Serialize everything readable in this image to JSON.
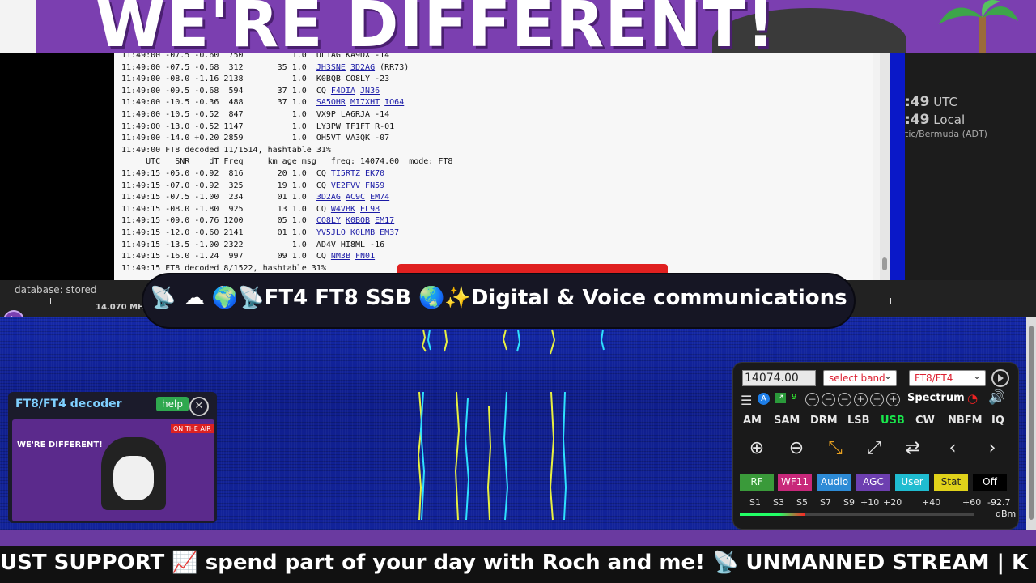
{
  "banner": {
    "title": "WE'RE DIFFERENT!"
  },
  "log": {
    "lines": [
      [
        {
          "t": "11:49:00 -07.5 -0.60  750          1.0  UL1AG KA9DX -14"
        }
      ],
      [
        {
          "t": "11:49:00 -07.5 -0.68  312       35 1.0  "
        },
        {
          "t": "JH3SNE",
          "l": 1
        },
        {
          "t": " "
        },
        {
          "t": "3D2AG",
          "l": 1
        },
        {
          "t": " (RR73)"
        }
      ],
      [
        {
          "t": "11:49:00 -08.0 -1.16 2138          1.0  K0BQB CO8LY -23"
        }
      ],
      [
        {
          "t": "11:49:00 -09.5 -0.68  594       37 1.0  CQ "
        },
        {
          "t": "F4DIA",
          "l": 1
        },
        {
          "t": " "
        },
        {
          "t": "JN36",
          "l": 1
        }
      ],
      [
        {
          "t": "11:49:00 -10.5 -0.36  488       37 1.0  "
        },
        {
          "t": "SA5OHR",
          "l": 1
        },
        {
          "t": " "
        },
        {
          "t": "MI7XHT",
          "l": 1
        },
        {
          "t": " "
        },
        {
          "t": "IO64",
          "l": 1
        }
      ],
      [
        {
          "t": "11:49:00 -10.5 -0.52  847          1.0  VX9P LA6RJA -14"
        }
      ],
      [
        {
          "t": "11:49:00 -13.0 -0.52 1147          1.0  LY3PW TF1FT R-01"
        }
      ],
      [
        {
          "t": "11:49:00 -14.0 +0.20 2859          1.0  OH5VT VA3QK -07"
        }
      ],
      [
        {
          "t": "11:49:00 FT8 decoded 11/1514, hashtable 31%"
        }
      ],
      [
        {
          "t": "     UTC   SNR    dT Freq     km age msg   freq: 14074.00  mode: FT8"
        }
      ],
      [
        {
          "t": "11:49:15 -05.0 -0.92  816       20 1.0  CQ "
        },
        {
          "t": "TI5RTZ",
          "l": 1
        },
        {
          "t": " "
        },
        {
          "t": "EK70",
          "l": 1
        }
      ],
      [
        {
          "t": "11:49:15 -07.0 -0.92  325       19 1.0  CQ "
        },
        {
          "t": "VE2FVV",
          "l": 1
        },
        {
          "t": " "
        },
        {
          "t": "FN59",
          "l": 1
        }
      ],
      [
        {
          "t": "11:49:15 -07.5 -1.00  234       01 1.0  "
        },
        {
          "t": "3D2AG",
          "l": 1
        },
        {
          "t": " "
        },
        {
          "t": "AC9C",
          "l": 1
        },
        {
          "t": " "
        },
        {
          "t": "EM74",
          "l": 1
        }
      ],
      [
        {
          "t": "11:49:15 -08.0 -1.80  925       13 1.0  CQ "
        },
        {
          "t": "W4VBK",
          "l": 1
        },
        {
          "t": " "
        },
        {
          "t": "EL98",
          "l": 1
        }
      ],
      [
        {
          "t": "11:49:15 -09.0 -0.76 1200       05 1.0  "
        },
        {
          "t": "CO8LY",
          "l": 1
        },
        {
          "t": " "
        },
        {
          "t": "K0BQB",
          "l": 1
        },
        {
          "t": " "
        },
        {
          "t": "EM17",
          "l": 1
        }
      ],
      [
        {
          "t": "11:49:15 -12.0 -0.60 2141       01 1.0  "
        },
        {
          "t": "YV5JLO",
          "l": 1
        },
        {
          "t": " "
        },
        {
          "t": "K0LMB",
          "l": 1
        },
        {
          "t": " "
        },
        {
          "t": "EM37",
          "l": 1
        }
      ],
      [
        {
          "t": "11:49:15 -13.5 -1.00 2322          1.0  AD4V HI8ML -16"
        }
      ],
      [
        {
          "t": "11:49:15 -16.0 -1.24  997       09 1.0  CQ "
        },
        {
          "t": "NM3B",
          "l": 1
        },
        {
          "t": " "
        },
        {
          "t": "FN01",
          "l": 1
        }
      ],
      [
        {
          "t": "11:49:15 FT8 decoded 8/1522, hashtable 31%"
        }
      ]
    ]
  },
  "clock": {
    "utc_min": ":49",
    "utc_label": "UTC",
    "local_min": ":49",
    "local_label": "Local",
    "tz": "tic/Bermuda (ADT)"
  },
  "scale": {
    "db_status": "database: stored",
    "freq_label": "14.070 MHz"
  },
  "title_pill": "📡 ☁ 🌍📡FT4 FT8 SSB 🌏✨Digital & Voice communications",
  "decoder": {
    "title": "FT8/FT4 decoder",
    "help": "help",
    "close": "✕",
    "thumb": {
      "heading": "WE'RE DIFFERENT!",
      "on_air": "ON THE AIR"
    }
  },
  "controls": {
    "freq_value": "14074.00",
    "band_select": "select band",
    "mode_select": "FT8/FT4",
    "spectrum": "Spectrum",
    "modes": [
      "AM",
      "SAM",
      "DRM",
      "LSB",
      "USB",
      "CW",
      "NBFM",
      "IQ"
    ],
    "active_mode": "USB",
    "bottom_buttons": [
      {
        "label": "RF",
        "bg": "#3a9a3a",
        "fg": "#e8ffe8"
      },
      {
        "label": "WF11",
        "bg": "#c8287a",
        "fg": "#ffffff"
      },
      {
        "label": "Audio",
        "bg": "#2d8bd6",
        "fg": "#ffffff"
      },
      {
        "label": "AGC",
        "bg": "#6d3fb0",
        "fg": "#ffffff"
      },
      {
        "label": "User",
        "bg": "#1fbcd0",
        "fg": "#ffffff"
      },
      {
        "label": "Stat",
        "bg": "#e0d21a",
        "fg": "#222222"
      },
      {
        "label": "Off",
        "bg": "#000000",
        "fg": "#ffffff"
      }
    ],
    "smeter": {
      "labels": [
        "S1",
        "S3",
        "S5",
        "S7",
        "S9",
        "+10",
        "+20",
        "+40",
        "+60"
      ],
      "reading": "-92.7",
      "unit": "dBm",
      "level": 0.28
    }
  },
  "ticker": "UST SUPPORT 📈 spend part of your day with Roch and me!        📡 UNMANNED STREAM | K"
}
